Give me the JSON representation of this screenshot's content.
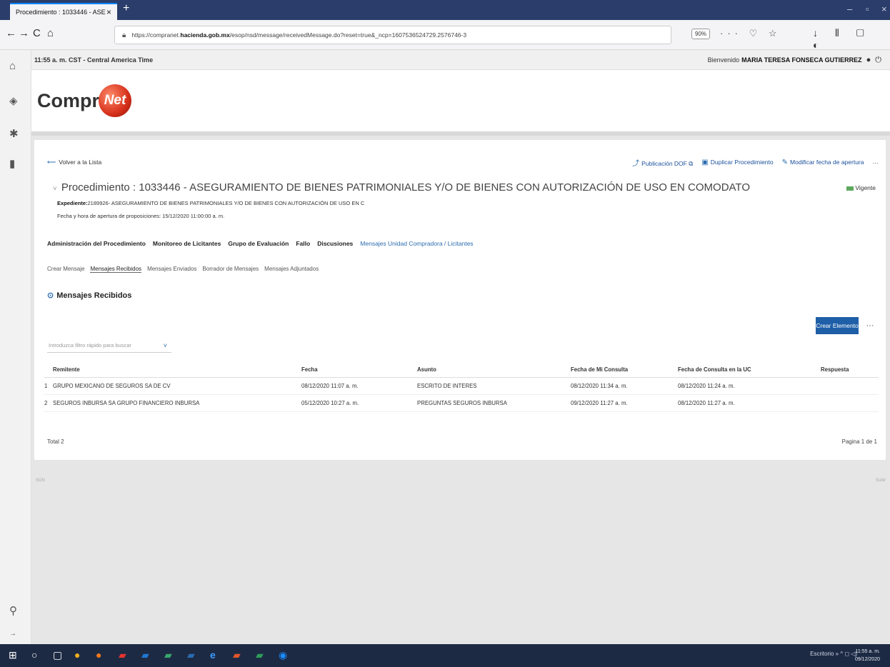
{
  "browser": {
    "tab_title": "Procedimiento : 1033446 - ASE",
    "tab_close": "×",
    "new_tab": "+",
    "minimize": "–",
    "restore": "▫",
    "close": "×",
    "back": "←",
    "forward": "→",
    "reload": "C",
    "home": "⌂",
    "url_prefix": "https://compranet.",
    "url_domain": "hacienda.gob.mx",
    "url_rest": "/esop/nsd/message/receivedMessage.do?reset=true&_ncp=1607536524729.2576746-3",
    "zoom": "90%",
    "url_icons": "··· ♡ ☆",
    "toolbar_icons": "↓ ⫴ ▢ ◐"
  },
  "rail": {
    "home_icon": "⌂",
    "apps_icon": "◈",
    "puzzle_icon": "✱",
    "doc_icon": "▮",
    "search_icon": "⚲",
    "expand_icon": "→"
  },
  "header": {
    "time": "11:55 a. m. CST - Central America Time",
    "welcome_label": "Bienvenido",
    "user_name": "MARIA TERESA FONSECA GUTIERREZ",
    "user_icon": "●",
    "power_icon": "⏻"
  },
  "logo": {
    "text": "Compra",
    "globe_text": "Net"
  },
  "procedure": {
    "back_arrow": "⟵",
    "back_label": "Volver a la Lista",
    "actions": [
      {
        "icon": "⤴",
        "label": "Publicación DOF ⧉"
      },
      {
        "icon": "▣",
        "label": "Duplicar Procedimiento"
      },
      {
        "icon": "✎",
        "label": "Modificar fecha de apertura"
      },
      {
        "icon": "",
        "label": "···"
      }
    ],
    "caret": "˅",
    "title": "Procedimiento : 1033446 - ASEGURAMIENTO DE BIENES PATRIMONIALES Y/O DE BIENES CON AUTORIZACIÓN DE USO EN COMODATO",
    "status": "Vigente",
    "expediente_label": "Expediente:",
    "expediente_value": "2189926- ASEGURAMIENTO DE BIENES PATRIMONIALES Y/O DE BIENES CON AUTORIZACIÓN DE USO EN C",
    "date_line": "Fecha y hora de apertura de proposiciones: 15/12/2020 11:00:00 a. m."
  },
  "main_tabs": [
    "Administración del Procedimiento",
    "Monitoreo de Licitantes",
    "Grupo de Evaluación",
    "Fallo",
    "Discusiones",
    "Mensajes Unidad Compradora / Licitantes"
  ],
  "sub_tabs": [
    "Crear Mensaje",
    "Mensajes Recibidos",
    "Mensajes Enviados",
    "Borrador de Mensajes",
    "Mensajes Adjuntados"
  ],
  "section": {
    "icon": "⊙",
    "title": "Mensajes Recibidos",
    "create_button": "Crear Elemento",
    "more_button": "···",
    "filter_placeholder": "Introduzca filtro rápido para buscar",
    "filter_chevron": "˅"
  },
  "table": {
    "headers": [
      "Remitente",
      "Fecha",
      "Asunto",
      "Fecha de Mi Consulta",
      "Fecha de Consulta en la UC",
      "Respuesta"
    ],
    "rows": [
      {
        "n": "1",
        "remitente": "GRUPO MEXICANO DE SEGUROS SA DE CV",
        "fecha": "08/12/2020 11:07 a. m.",
        "asunto": "ESCRITO DE INTERES",
        "mi_consulta": "08/12/2020 11:34 a. m.",
        "uc_consulta": "08/12/2020 11:24 a. m.",
        "respuesta": ""
      },
      {
        "n": "2",
        "remitente": "SEGUROS INBURSA SA GRUPO FINANCIERO INBURSA",
        "fecha": "05/12/2020 10:27 a. m.",
        "asunto": "PREGUNTAS SEGUROS INBURSA",
        "mi_consulta": "09/12/2020 11:27 a. m.",
        "uc_consulta": "08/12/2020 11:27 a. m.",
        "respuesta": ""
      }
    ],
    "total": "Total 2",
    "pagination": "Pagina 1 de 1"
  },
  "footer": {
    "left": "SGN",
    "right": "Subir"
  },
  "taskbar": {
    "icons": [
      {
        "name": "windows-start-icon",
        "glyph": "⊞",
        "color": "#ffffff"
      },
      {
        "name": "search-circle-icon",
        "glyph": "○",
        "color": "#ffffff"
      },
      {
        "name": "task-view-icon",
        "glyph": "▢",
        "color": "#ffffff"
      },
      {
        "name": "chrome-icon",
        "glyph": "●",
        "color": "#f2b01e"
      },
      {
        "name": "firefox-icon",
        "glyph": "●",
        "color": "#ff7a1a"
      },
      {
        "name": "acrobat-icon",
        "glyph": "▰",
        "color": "#e3342f"
      },
      {
        "name": "outlook-icon",
        "glyph": "▰",
        "color": "#1f78d1"
      },
      {
        "name": "app-green-icon",
        "glyph": "▰",
        "color": "#3aa76d"
      },
      {
        "name": "word-icon",
        "glyph": "▰",
        "color": "#2b6cb0"
      },
      {
        "name": "edge-icon",
        "glyph": "e",
        "color": "#3b9cff"
      },
      {
        "name": "powerpoint-icon",
        "glyph": "▰",
        "color": "#e0562b"
      },
      {
        "name": "excel-icon",
        "glyph": "▰",
        "color": "#2e9c5b"
      },
      {
        "name": "teamviewer-icon",
        "glyph": "◉",
        "color": "#1a8cff"
      }
    ],
    "tray_text": "Escritorio » ^ ◻ ◁)",
    "time": "11:55 a. m.",
    "date": "09/12/2020"
  }
}
